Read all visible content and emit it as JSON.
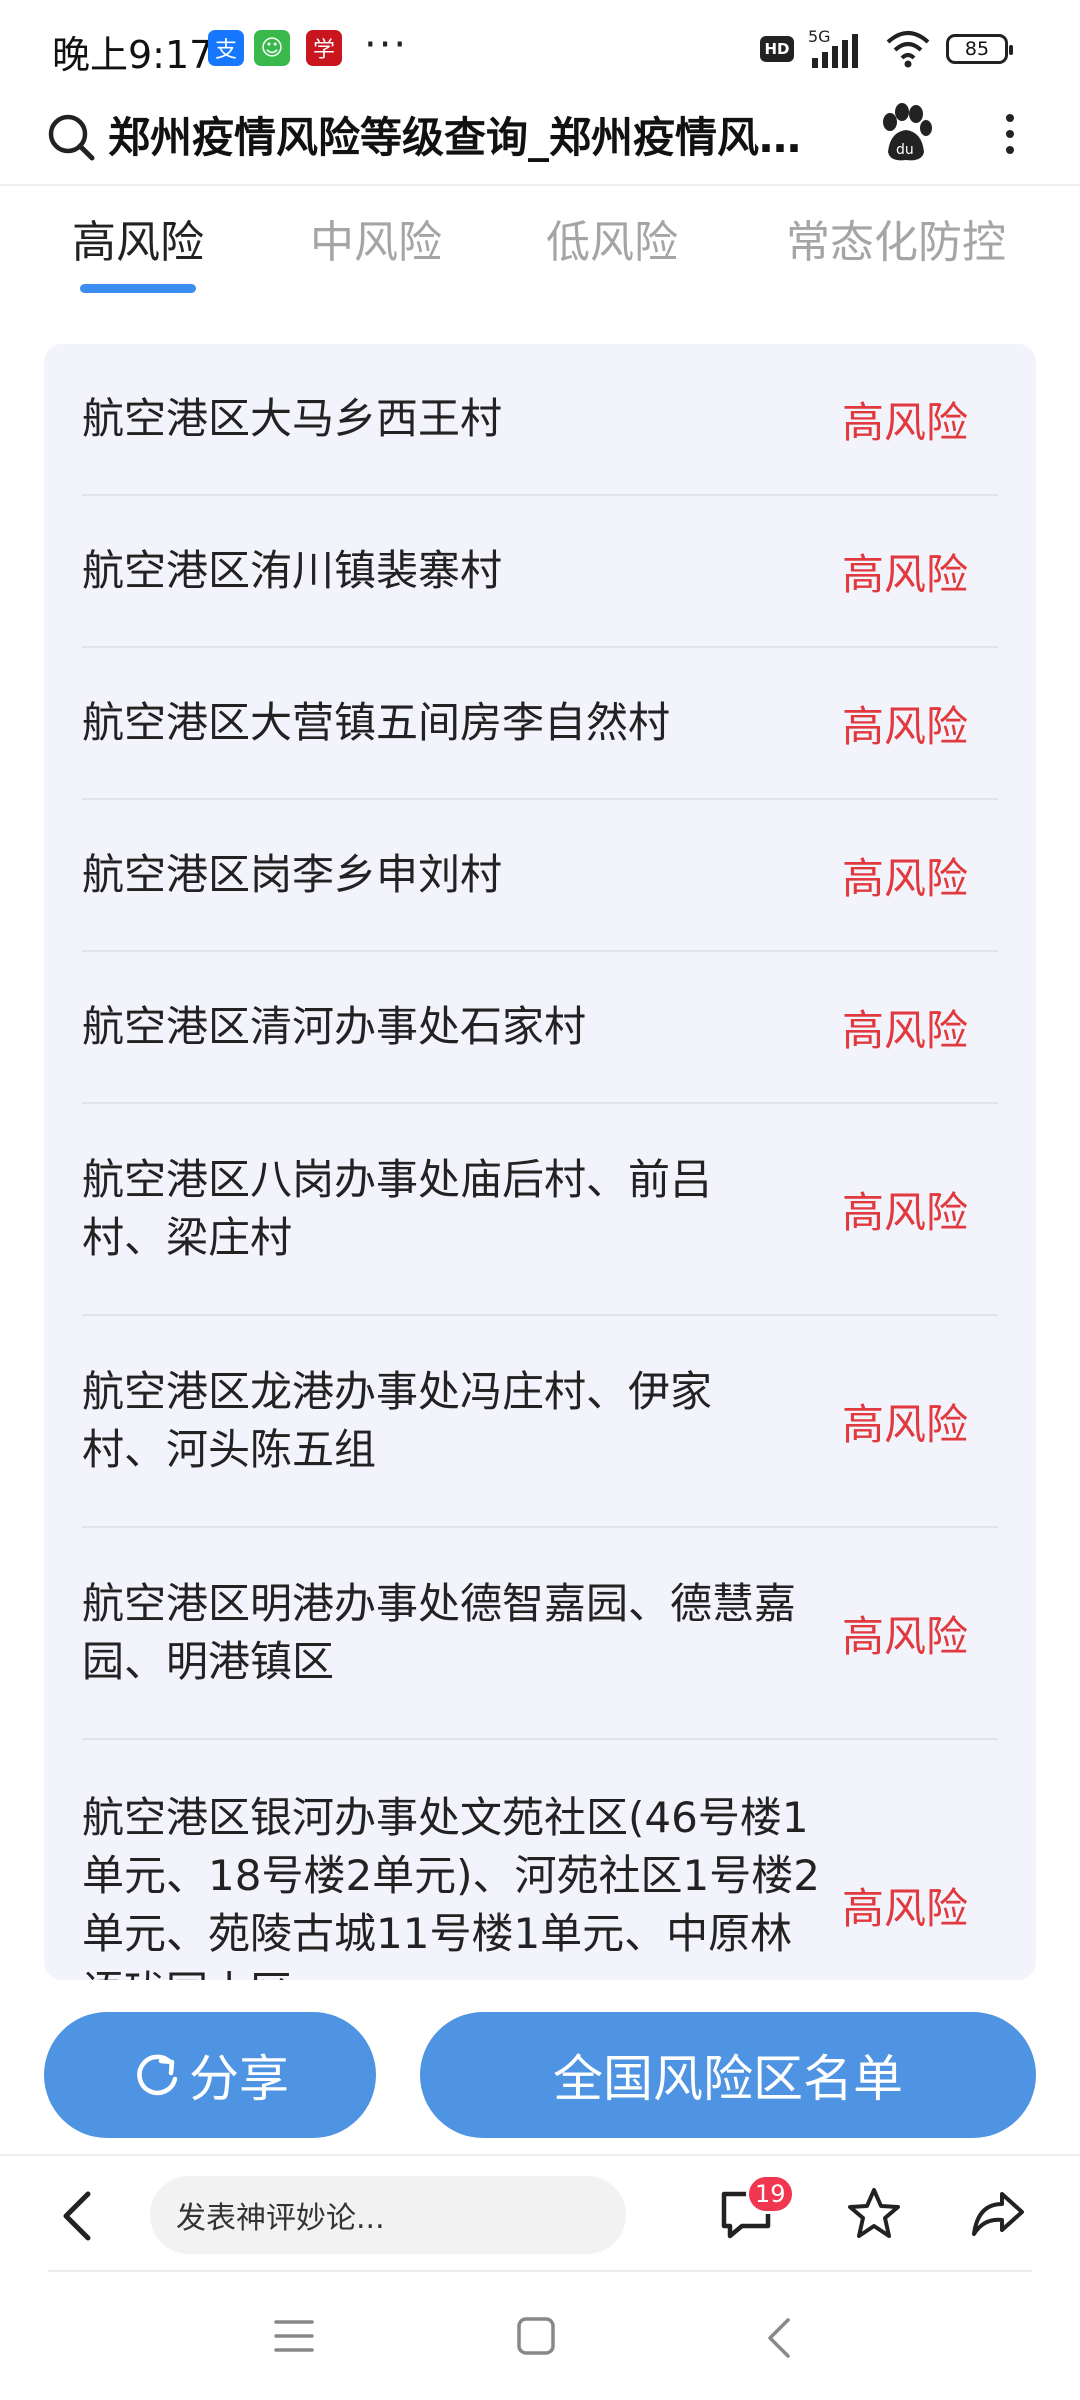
{
  "status_bar": {
    "time": "晚上9:17",
    "app_icons": [
      {
        "name": "alipay-icon",
        "glyph": "支",
        "color": "#1677ff"
      },
      {
        "name": "wechat-mini-icon",
        "glyph": "☺",
        "color": "#38b94a"
      },
      {
        "name": "red-app-icon",
        "glyph": "学",
        "color": "#c9151e"
      }
    ],
    "more": "···",
    "hd": "HD",
    "network": "5G",
    "battery": "85"
  },
  "header": {
    "title": "郑州疫情风险等级查询_郑州疫情风险等级查询",
    "search_icon": "search-icon",
    "baidu_icon": "baidu-paw-icon",
    "menu_icon": "more-vertical-icon"
  },
  "tabs": [
    {
      "label": "高风险",
      "active": true
    },
    {
      "label": "中风险",
      "active": false
    },
    {
      "label": "低风险",
      "active": false
    },
    {
      "label": "常态化防控",
      "active": false
    }
  ],
  "risk_list": {
    "level_color": "#e0393e",
    "items": [
      {
        "name": "航空港区大马乡西王村",
        "level": "高风险"
      },
      {
        "name": "航空港区洧川镇裴寨村",
        "level": "高风险"
      },
      {
        "name": "航空港区大营镇五间房李自然村",
        "level": "高风险"
      },
      {
        "name": "航空港区岗李乡申刘村",
        "level": "高风险"
      },
      {
        "name": "航空港区清河办事处石家村",
        "level": "高风险"
      },
      {
        "name": "航空港区八岗办事处庙后村、前吕村、梁庄村",
        "level": "高风险"
      },
      {
        "name": "航空港区龙港办事处冯庄村、伊家村、河头陈五组",
        "level": "高风险"
      },
      {
        "name": "航空港区明港办事处德智嘉园、德慧嘉园、明港镇区",
        "level": "高风险"
      },
      {
        "name": "航空港区银河办事处文苑社区(46号楼1单元、18号楼2单元)、河苑社区1号楼2单元、苑陵古城11号楼1单元、中原林语珑园小区",
        "level": "高风险"
      }
    ]
  },
  "actions": {
    "share_label": "分享",
    "national_list_label": "全国风险区名单",
    "accent_color": "#4f94e3"
  },
  "comment_bar": {
    "placeholder": "发表神评妙论...",
    "comment_count": "19"
  },
  "nav": {
    "icons": [
      "menu-icon",
      "home-square-icon",
      "back-chevron-icon"
    ]
  }
}
